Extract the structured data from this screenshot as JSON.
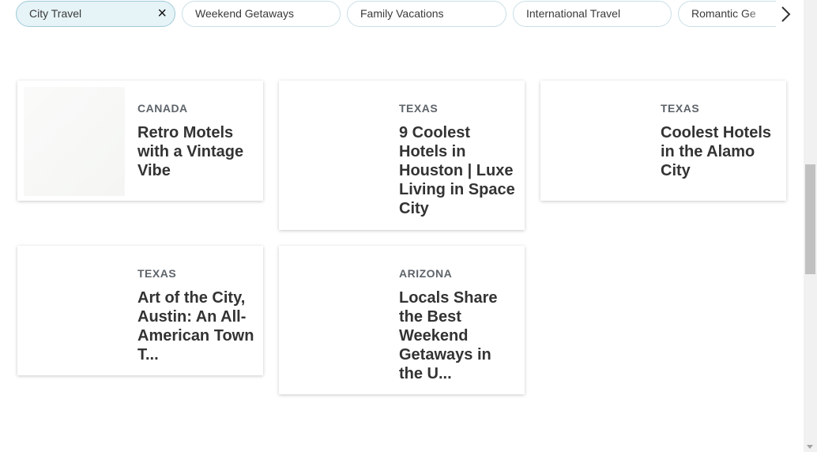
{
  "filters": {
    "chips": [
      {
        "label": "City Travel",
        "active": true
      },
      {
        "label": "Weekend Getaways",
        "active": false
      },
      {
        "label": "Family Vacations",
        "active": false
      },
      {
        "label": "International Travel",
        "active": false
      },
      {
        "label": "Romantic Ge",
        "active": false
      }
    ],
    "clear_icon": "×"
  },
  "cards": [
    {
      "location": "CANADA",
      "title": "Retro Motels with a Vintage Vibe"
    },
    {
      "location": "TEXAS",
      "title": "9 Coolest Hotels in Houston | Luxe Living in Space City"
    },
    {
      "location": "TEXAS",
      "title": "Coolest Hotels in the Alamo City"
    },
    {
      "location": "TEXAS",
      "title": "Art of the City, Austin: An All-American Town T..."
    },
    {
      "location": "ARIZONA",
      "title": "Locals Share the Best Weekend Getaways in the U..."
    }
  ]
}
